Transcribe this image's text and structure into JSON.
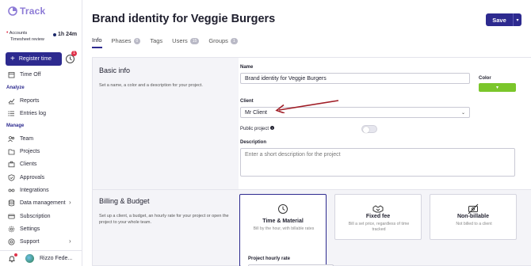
{
  "app": {
    "name": "Track",
    "accent": "#2d2a8f",
    "logo_color": "#8d7bd6"
  },
  "sidebar": {
    "accounts_label": "Accounts",
    "timesheet_label": "Timesheet review",
    "timer": "1h 24m",
    "register_label": "Register time",
    "clock_badge": "1",
    "time_off": "Time Off",
    "analyze_label": "Analyze",
    "reports": "Reports",
    "entries_log": "Entries log",
    "manage_label": "Manage",
    "team": "Team",
    "projects": "Projects",
    "clients": "Clients",
    "approvals": "Approvals",
    "integrations": "Integrations",
    "data_management": "Data management",
    "subscription": "Subscription",
    "settings": "Settings",
    "support": "Support",
    "user_name": "Rizzo Fede..."
  },
  "header": {
    "title": "Brand identity for Veggie Burgers",
    "save_label": "Save"
  },
  "tabs": [
    {
      "label": "Info",
      "badge": ""
    },
    {
      "label": "Phases",
      "badge": "0"
    },
    {
      "label": "Tags",
      "badge": ""
    },
    {
      "label": "Users",
      "badge": "15"
    },
    {
      "label": "Groups",
      "badge": "1"
    }
  ],
  "basic_info": {
    "title": "Basic info",
    "desc": "Set a name, a color and a description for your project.",
    "name_label": "Name",
    "name_value": "Brand identity for Veggie Burgers",
    "color_label": "Color",
    "color_value": "#7bc62b",
    "client_label": "Client",
    "client_value": "Mr Client",
    "public_label": "Public project",
    "description_label": "Description",
    "description_placeholder": "Enter a short description for the project"
  },
  "billing": {
    "title": "Billing & Budget",
    "desc": "Set up a client, a budget, an hourly rate for your project or open the project to your whole team.",
    "cards": [
      {
        "title": "Time & Material",
        "sub": "Bill by the hour, with billable rates",
        "icon": "clock-icon"
      },
      {
        "title": "Fixed fee",
        "sub": "Bill a set price, regardless of time tracked",
        "icon": "handshake-icon"
      },
      {
        "title": "Non-billable",
        "sub": "Not billed to a client",
        "icon": "no-money-icon"
      }
    ],
    "rate_label": "Project hourly rate"
  }
}
